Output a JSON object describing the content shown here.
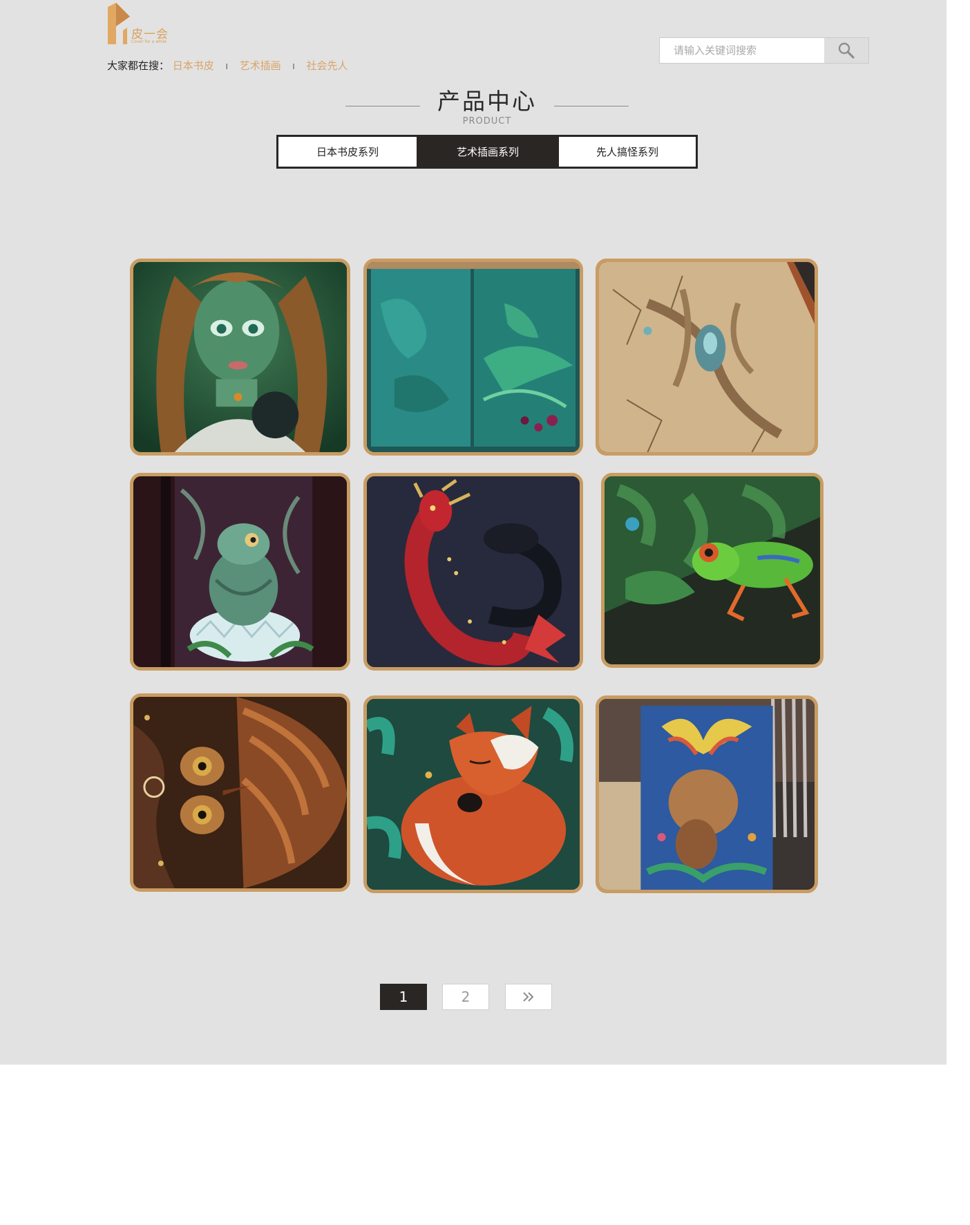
{
  "header": {
    "logo": {
      "text": "皮一会",
      "tagline": "Cover for a while"
    },
    "hot_search": {
      "label": "大家都在搜：",
      "keywords": [
        "日本书皮",
        "艺术插画",
        "社会先人"
      ],
      "separator": "I"
    },
    "search": {
      "placeholder": "请输入关键词搜索",
      "value": "",
      "icon": "search-icon"
    }
  },
  "section": {
    "title": "产品中心",
    "subtitle": "PRODUCT"
  },
  "tabs": [
    {
      "label": "日本书皮系列",
      "active": false
    },
    {
      "label": "艺术插画系列",
      "active": true
    },
    {
      "label": "先人搞怪系列",
      "active": false
    }
  ],
  "products": [
    {
      "subject": "green-faced fairy girl with long hair holding a dark orb"
    },
    {
      "subject": "teal sculpted open book with ferns and a hummingbird"
    },
    {
      "subject": "cracked bronze book cover with tangled roots and gem"
    },
    {
      "subject": "baby dragon hatching from an egg on a purple book"
    },
    {
      "subject": "red and black dragon sculpture with gold jewels"
    },
    {
      "subject": "green tree frog on a leafy green book cover"
    },
    {
      "subject": "copper owl face sculpted on a book cover"
    },
    {
      "subject": "sleeping red fox and cub among teal leaves"
    },
    {
      "subject": "painted moose with colorful antlers on a notebook"
    }
  ],
  "pagination": {
    "pages": [
      "1",
      "2"
    ],
    "current": "1",
    "next_icon": "double-chevron-right-icon"
  },
  "colors": {
    "accent": "#c99c62",
    "keyword": "#d9a46a",
    "dark": "#2a2624",
    "background": "#e2e2e2"
  }
}
